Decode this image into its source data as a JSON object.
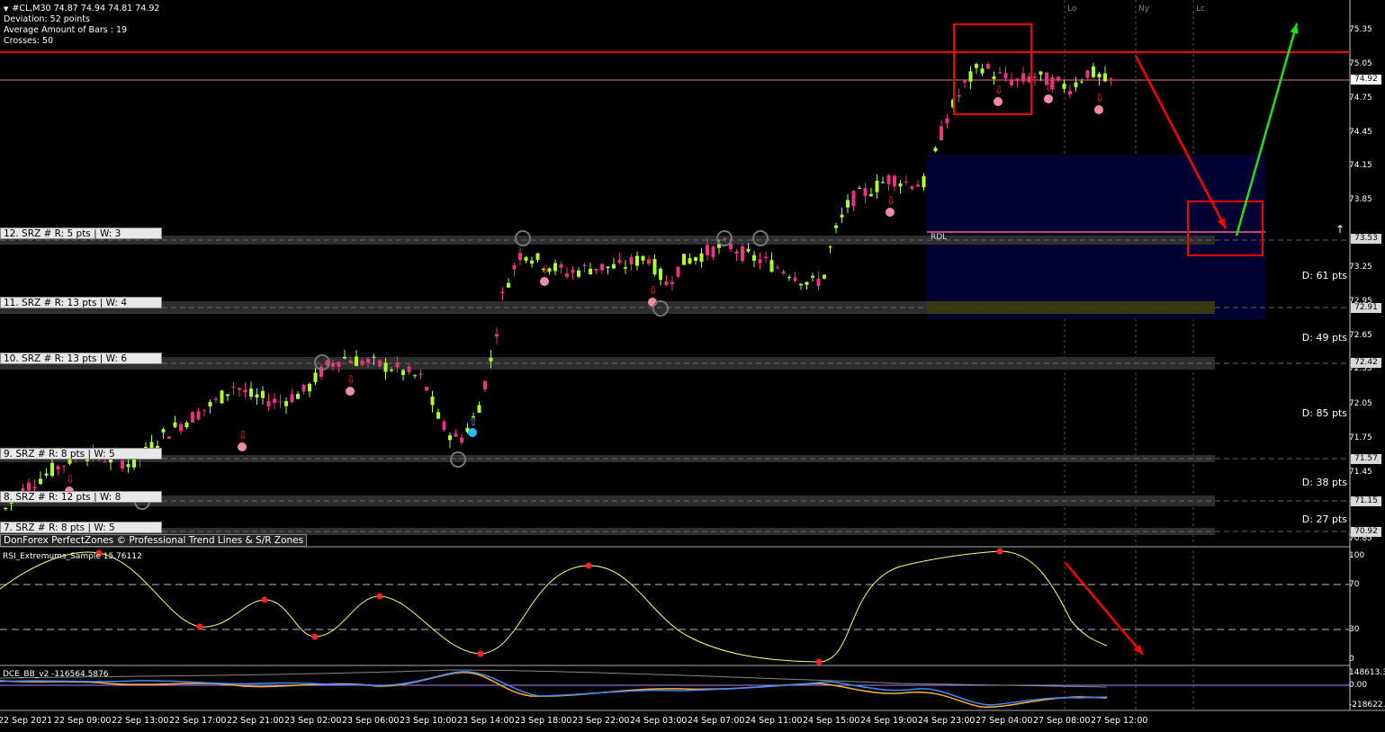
{
  "header": {
    "symbol_line": "#CL,M30  74.87 74.94 74.81 74.92",
    "deviation": "Deviation: 52 points",
    "avg_bars": "Average Amount of Bars : 19",
    "crosses": "Crosses: 50"
  },
  "sessions": [
    "Lo",
    "Ny",
    "Lc"
  ],
  "zones": [
    {
      "label": "12. SRZ # R: 5 pts | W: 3",
      "tag": "73.53"
    },
    {
      "label": "11. SRZ # R: 13 pts | W: 4",
      "tag": "72.91"
    },
    {
      "label": "10. SRZ # R: 13 pts | W: 6",
      "tag": "72.42"
    },
    {
      "label": "9. SRZ # R: 8 pts | W: 5",
      "tag": "71.57"
    },
    {
      "label": "8. SRZ # R: 12 pts | W: 8",
      "tag": "71.15"
    },
    {
      "label": "7. SRZ # R: 8 pts | W: 5",
      "tag": "70.92"
    }
  ],
  "distances": [
    "D: 61 pts",
    "D: 49 pts",
    "D: 85 pts",
    "D: 38 pts",
    "D: 27 pts"
  ],
  "rdl_label": "RDL",
  "copyright": "DonForex PerfectZones © Professional Trend Lines & S/R Zones",
  "price_axis": [
    "75.35",
    "75.05",
    "74.75",
    "74.45",
    "74.15",
    "73.85",
    "73.25",
    "72.95",
    "72.65",
    "72.35",
    "72.05",
    "71.75",
    "71.45",
    "71.15",
    "70.85"
  ],
  "current_price": "74.92",
  "rsi": {
    "title": "RSI_Extremums_Sample 15.76112",
    "levels": [
      "100",
      "70",
      "30",
      "0"
    ]
  },
  "dce": {
    "title": "DCE_BB_v2 -116564.5876",
    "levels": [
      "148613.3",
      "0.00",
      "-218622."
    ]
  },
  "time_axis": [
    "22 Sep 2021",
    "22 Sep 09:00",
    "22 Sep 13:00",
    "22 Sep 17:00",
    "22 Sep 21:00",
    "23 Sep 02:00",
    "23 Sep 06:00",
    "23 Sep 10:00",
    "23 Sep 14:00",
    "23 Sep 18:00",
    "23 Sep 22:00",
    "24 Sep 03:00",
    "24 Sep 07:00",
    "24 Sep 11:00",
    "24 Sep 15:00",
    "24 Sep 19:00",
    "24 Sep 23:00",
    "27 Sep 04:00",
    "27 Sep 08:00",
    "27 Sep 12:00"
  ],
  "colors": {
    "bull": "#adff2f",
    "bear": "#e8357d",
    "resistance": "#ff0000",
    "zone": "#2e2e2e",
    "projection": "#000033",
    "rsi_line": "#ffff80",
    "dce_blue": "#3d8bff",
    "dce_orange": "#ffb030",
    "annotation_red": "#ff0000",
    "annotation_green": "#22dd22"
  },
  "icons": [
    "down-arrow-signal-icon",
    "up-arrow-signal-icon",
    "scroll-up-arrow-icon"
  ]
}
